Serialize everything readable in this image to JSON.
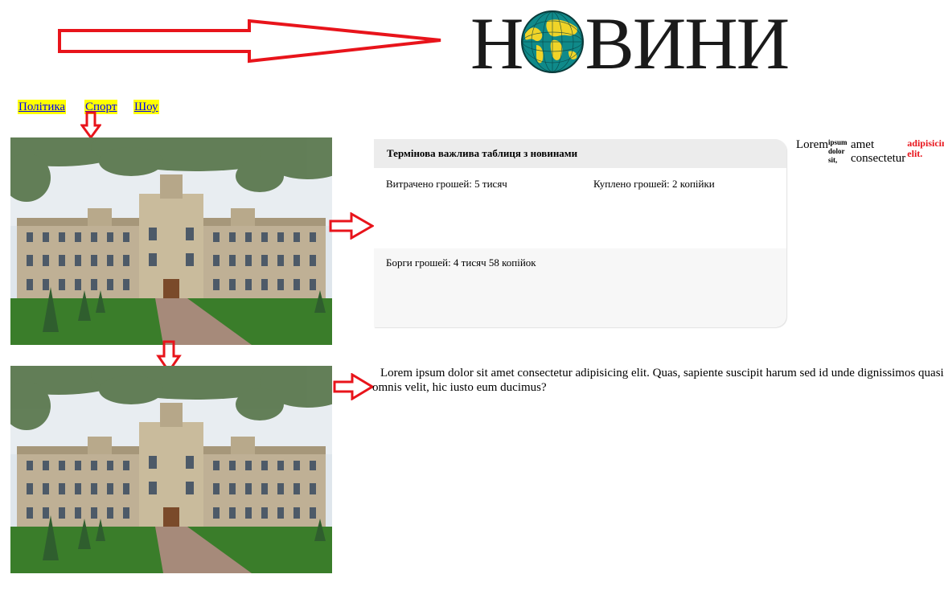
{
  "logo": {
    "text": "НОВИНИ"
  },
  "nav": {
    "items": [
      {
        "label": "Політика"
      },
      {
        "label": "Спорт"
      },
      {
        "label": "Шоу"
      }
    ]
  },
  "table": {
    "title": "Термінова важлива таблиця з новинами",
    "spent": "Витрачено грошей: 5 тисяч",
    "bought": "Куплено грошей: 2 копійки",
    "debts": "Борги грошей: 4 тисяч 58 копійок"
  },
  "side_text": {
    "w1": "Lorem",
    "w2": "ipsum",
    "w3": "dolor",
    "w4": "sit,",
    "w5": "amet",
    "w6": "consectetur",
    "w7": "adipisicing",
    "w8": "elit."
  },
  "paragraph": "Lorem ipsum dolor sit amet consectetur adipisicing elit. Quas, sapiente suscipit harum sed id unde dignissimos quasi omnis velit, hic iusto eum ducimus?",
  "colors": {
    "arrow": "#e8141b",
    "nav_highlight": "#ffff00",
    "link": "#0000ee",
    "table_head": "#ececec"
  }
}
